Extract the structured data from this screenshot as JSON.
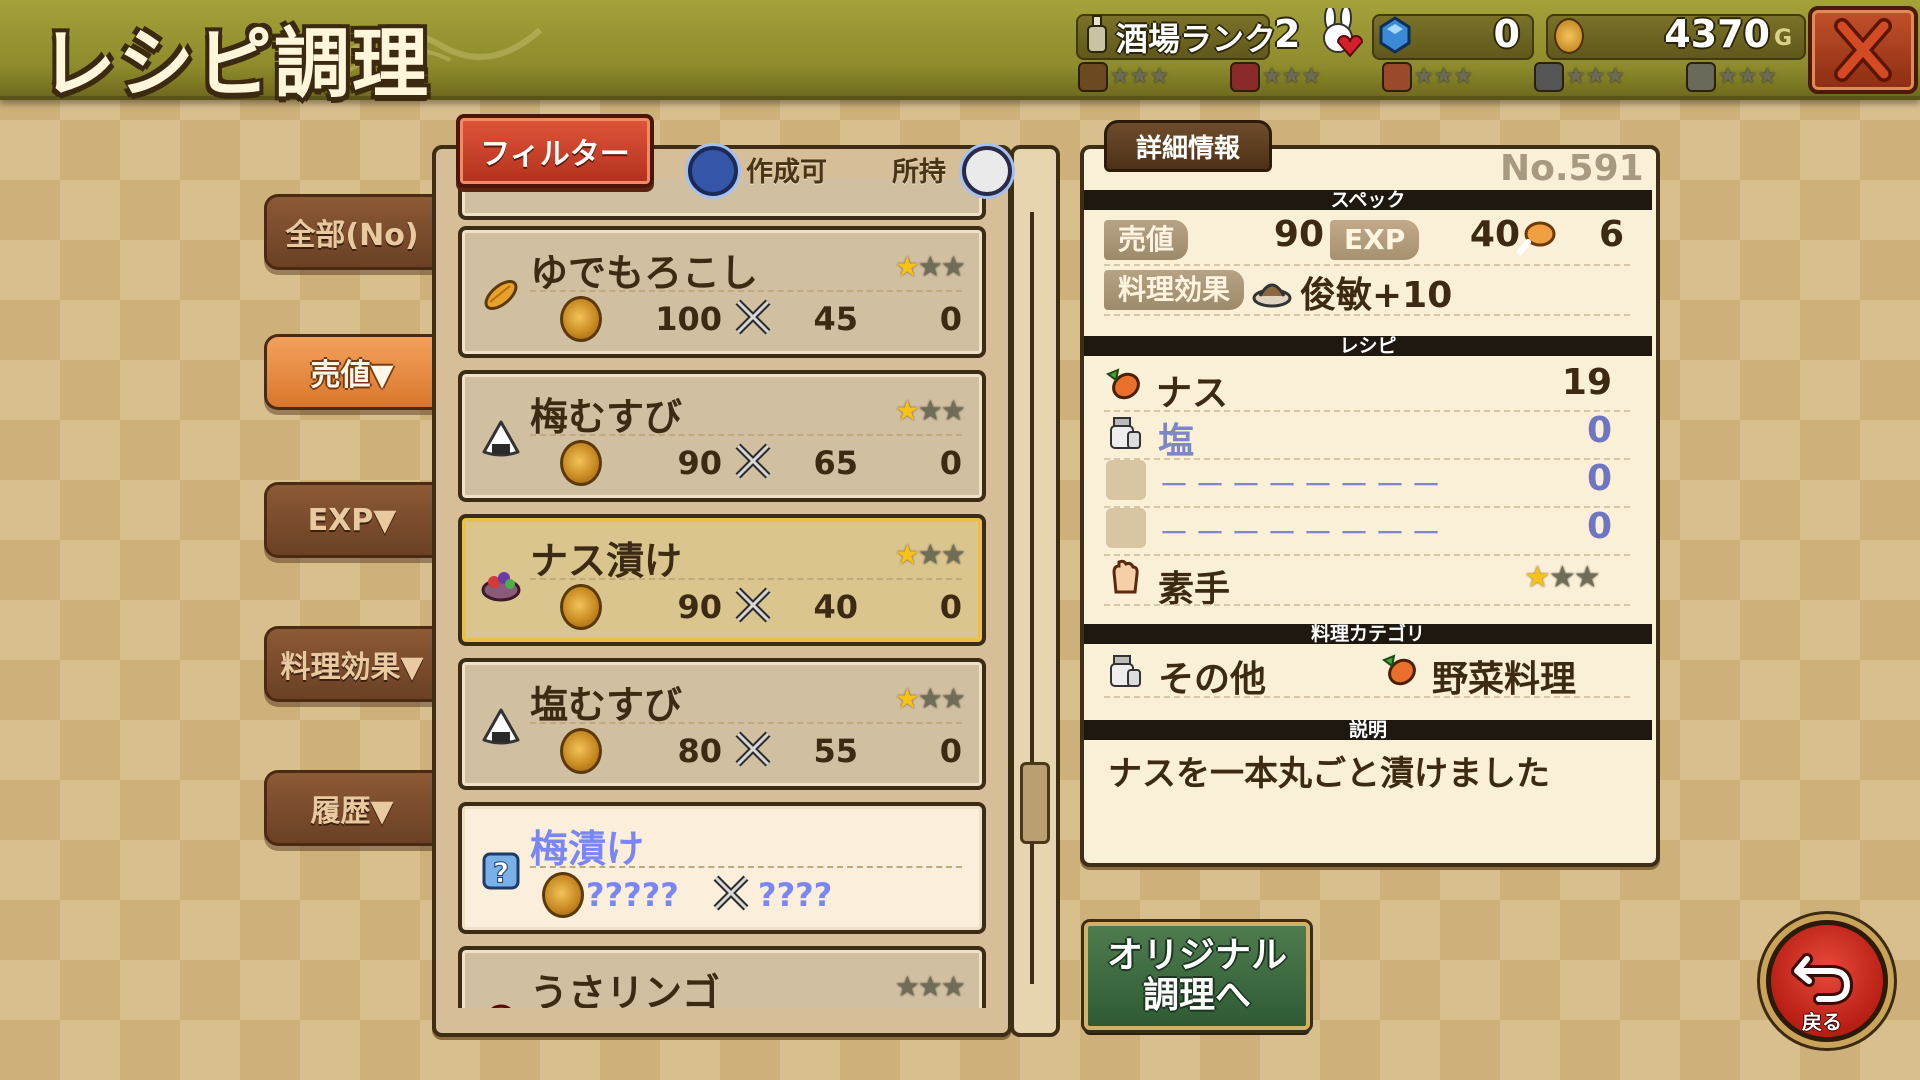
{
  "header": {
    "title": "レシピ調理",
    "tavern_rank_label": "酒場ランク",
    "tavern_rank_value": "2",
    "gems": "0",
    "gold": "4370",
    "gold_unit": "G"
  },
  "side_tabs": [
    {
      "label": "全部(No)",
      "active": false
    },
    {
      "label": "売値▼",
      "active": true
    },
    {
      "label": "EXP▼",
      "active": false
    },
    {
      "label": "料理効果▼",
      "active": false
    },
    {
      "label": "履歴▼",
      "active": false
    }
  ],
  "list": {
    "filter_label": "フィルター",
    "craftable_label": "作成可",
    "owned_label": "所持",
    "items": [
      {
        "name": "ゆでもろこし",
        "price": "100",
        "exp": "45",
        "owned": "0",
        "stars": 1,
        "icon": "corn-icon",
        "state": "normal"
      },
      {
        "name": "梅むすび",
        "price": "90",
        "exp": "65",
        "owned": "0",
        "stars": 1,
        "icon": "onigiri-icon",
        "state": "normal"
      },
      {
        "name": "ナス漬け",
        "price": "90",
        "exp": "40",
        "owned": "0",
        "stars": 1,
        "icon": "pickled-eggplant-icon",
        "state": "selected"
      },
      {
        "name": "塩むすび",
        "price": "80",
        "exp": "55",
        "owned": "0",
        "stars": 1,
        "icon": "onigiri-icon",
        "state": "normal"
      },
      {
        "name": "梅漬け",
        "price": "?????",
        "exp": "????",
        "owned": "",
        "stars": 0,
        "icon": "unknown-icon",
        "state": "unknown"
      },
      {
        "name": "うさリンゴ",
        "price": "",
        "exp": "",
        "owned": "",
        "stars": 0,
        "icon": "apple-icon",
        "state": "normal"
      }
    ]
  },
  "detail": {
    "tab_label": "詳細情報",
    "number": "No.591",
    "spec_header": "スペック",
    "price_label": "売値",
    "price_value": "90",
    "exp_label": "EXP",
    "exp_value": "40",
    "extra_value": "6",
    "effect_label": "料理効果",
    "effect_value": "俊敏+10",
    "recipe_header": "レシピ",
    "ingredients": [
      {
        "name": "ナス",
        "count": "19",
        "dim": false,
        "icon": "eggplant-icon"
      },
      {
        "name": "塩",
        "count": "0",
        "dim": true,
        "icon": "salt-jar-icon"
      },
      {
        "name": "－－－－－－－－",
        "count": "0",
        "dim": true,
        "icon": "empty-slot"
      },
      {
        "name": "－－－－－－－－",
        "count": "0",
        "dim": true,
        "icon": "empty-slot"
      }
    ],
    "tool_name": "素手",
    "tool_stars": 1,
    "category_header": "料理カテゴリ",
    "category_1": "その他",
    "category_2": "野菜料理",
    "desc_header": "説明",
    "description": "ナスを一本丸ごと漬けました"
  },
  "buttons": {
    "original_line1": "オリジナル",
    "original_line2": "調理へ",
    "back_label": "戻る"
  },
  "colors": {
    "header": "#8d8b2c",
    "active_tab": "#e8893e",
    "selected_row": "#dac58f",
    "unknown_text": "#7a86f4"
  }
}
